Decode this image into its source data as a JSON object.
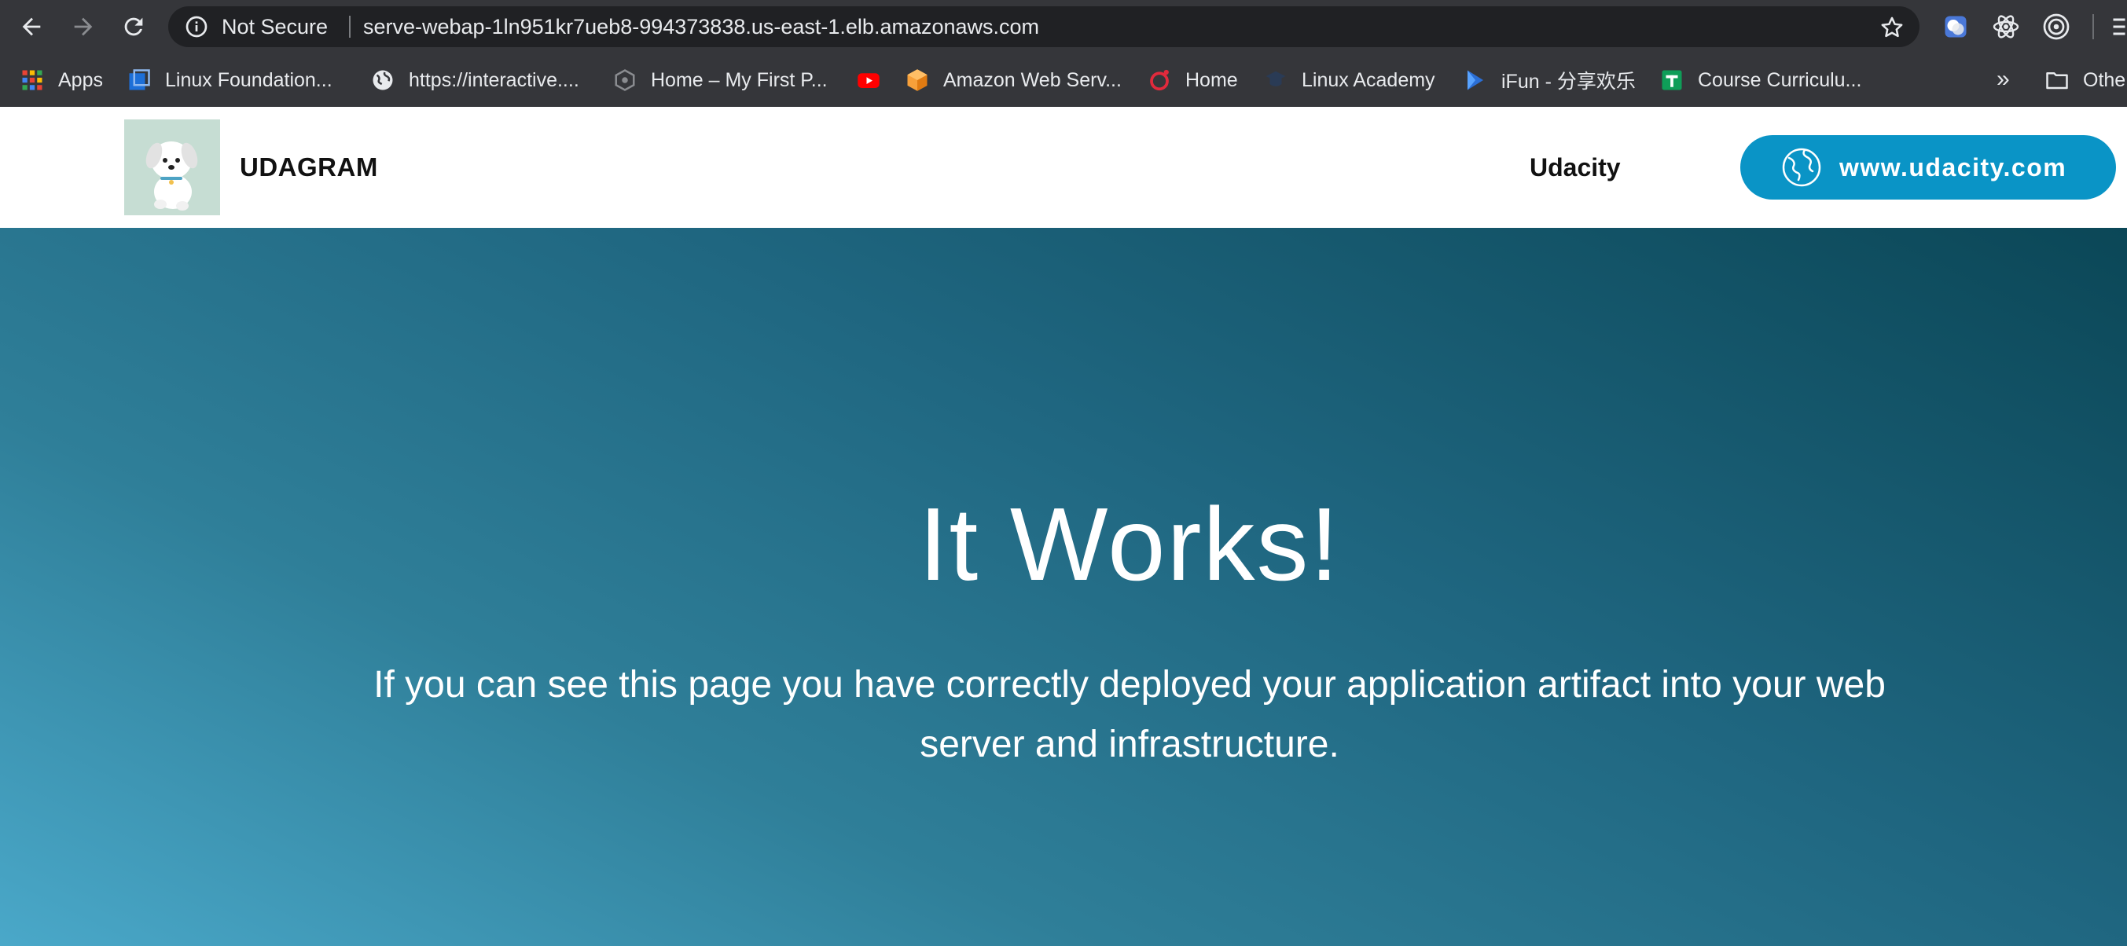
{
  "browser": {
    "security_label": "Not Secure",
    "url": "serve-webap-1ln951kr7ueb8-994373838.us-east-1.elb.amazonaws.com",
    "bookmarks": [
      {
        "label": "Apps",
        "icon": "apps-grid-icon"
      },
      {
        "label": "Linux Foundation...",
        "icon": "linux-foundation-icon"
      },
      {
        "label": "https://interactive....",
        "icon": "globe-icon"
      },
      {
        "label": "Home – My First P...",
        "icon": "webpage-icon"
      },
      {
        "label": "",
        "icon": "youtube-icon"
      },
      {
        "label": "Amazon Web Serv...",
        "icon": "aws-cube-icon"
      },
      {
        "label": "Home",
        "icon": "opera-icon"
      },
      {
        "label": "Linux Academy",
        "icon": "linux-academy-icon"
      },
      {
        "label": "iFun - 分享欢乐",
        "icon": "ifun-play-icon"
      },
      {
        "label": "Course Curriculu...",
        "icon": "google-sheets-icon"
      }
    ],
    "overflow_label": "»",
    "other_bookmarks_label": "Othe"
  },
  "header": {
    "brand": "UDAGRAM",
    "nav_link": "Udacity",
    "cta_label": "www.udacity.com"
  },
  "hero": {
    "title": "It Works!",
    "subtitle": "If you can see this page you have correctly deployed your application artifact into your web server and infrastructure."
  },
  "colors": {
    "browser_chrome": "#35363a",
    "omnibox": "#202124",
    "cta": "#0a94c6",
    "hero_gradient_start": "#4aa8c9",
    "hero_gradient_end": "#0b4757"
  }
}
